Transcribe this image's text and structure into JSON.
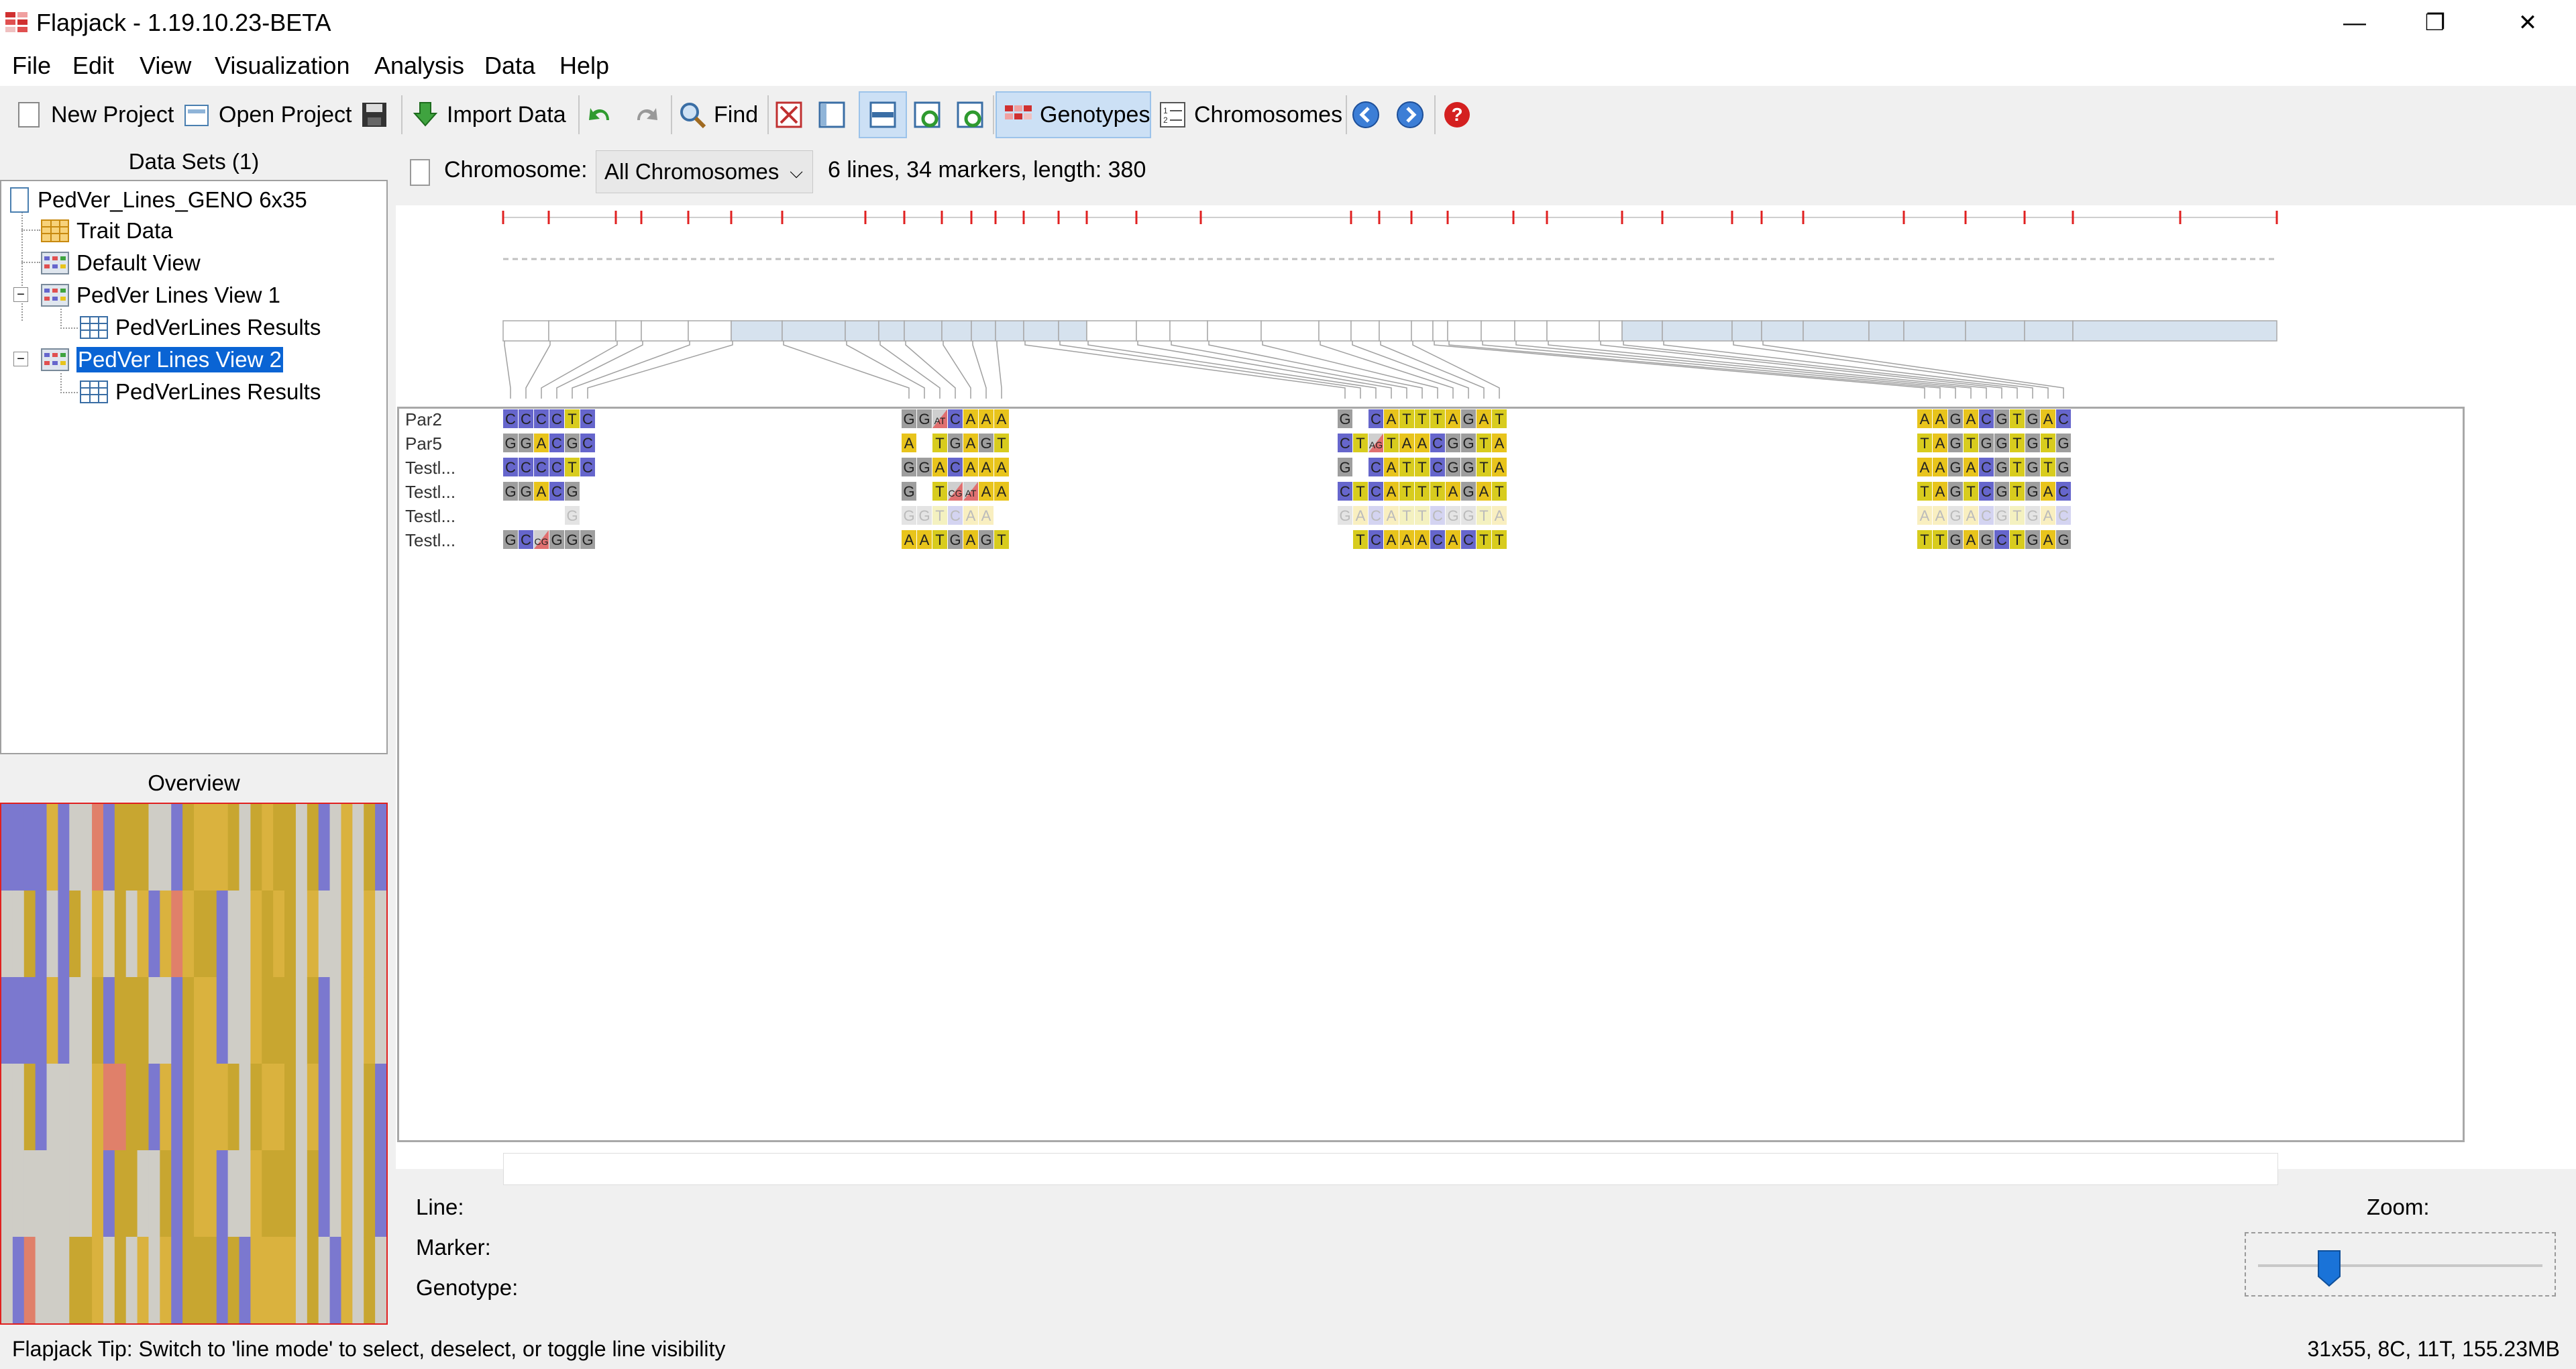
{
  "window": {
    "title": "Flapjack - 1.19.10.23-BETA",
    "min_icon": "—",
    "max_icon": "❐",
    "close_icon": "✕"
  },
  "menu": [
    "File",
    "Edit",
    "View",
    "Visualization",
    "Analysis",
    "Data",
    "Help"
  ],
  "toolbar": {
    "new_project": "New Project",
    "open_project": "Open Project",
    "import_data": "Import Data",
    "find": "Find",
    "genotypes": "Genotypes",
    "chromosomes": "Chromosomes"
  },
  "datasets": {
    "header": "Data Sets (1)",
    "root": "PedVer_Lines_GENO 6x35",
    "trait": "Trait Data",
    "default_view": "Default View",
    "view1": "PedVer Lines View 1",
    "view1_results": "PedVerLines Results",
    "view2": "PedVer Lines View 2",
    "view2_results": "PedVerLines Results"
  },
  "overview": {
    "header": "Overview"
  },
  "chromosome": {
    "label": "Chromosome:",
    "selected": "All Chromosomes",
    "info": "6 lines, 34 markers, length: 380"
  },
  "lines": [
    "Par2",
    "Par5",
    "Testl...",
    "Testl...",
    "Testl...",
    "Testl..."
  ],
  "genotype_blocks": [
    {
      "rows": [
        [
          "C",
          "C",
          "C",
          "C",
          "T",
          "C"
        ],
        [
          "G",
          "G",
          "A",
          "C",
          "G",
          "C"
        ],
        [
          "C",
          "C",
          "C",
          "C",
          "T",
          "C"
        ],
        [
          "G",
          "G",
          "A",
          "C",
          "G",
          ""
        ],
        [
          "",
          "",
          "",
          "",
          "G",
          ""
        ],
        [
          "G",
          "C",
          "C/G",
          "G",
          "G",
          "G"
        ]
      ]
    },
    {
      "rows": [
        [
          "G",
          "G",
          "A/T",
          "C",
          "A",
          "A",
          "A"
        ],
        [
          "A",
          "",
          "T",
          "G",
          "A",
          "G",
          "T"
        ],
        [
          "G",
          "G",
          "A",
          "C",
          "A",
          "A",
          "A"
        ],
        [
          "G",
          "",
          "T",
          "C/G",
          "A/T",
          "A",
          "A"
        ],
        [
          "G",
          "G",
          "T",
          "C",
          "A",
          "A",
          ""
        ],
        [
          "A",
          "A",
          "T",
          "G",
          "A",
          "G",
          "T"
        ]
      ]
    },
    {
      "rows": [
        [
          "G",
          "",
          "C",
          "A",
          "T",
          "T",
          "T",
          "A",
          "G",
          "A",
          "T"
        ],
        [
          "C",
          "T",
          "A/G",
          "T",
          "A",
          "A",
          "C",
          "G",
          "G",
          "T",
          "A"
        ],
        [
          "G",
          "",
          "C",
          "A",
          "T",
          "T",
          "C",
          "G",
          "G",
          "T",
          "A"
        ],
        [
          "C",
          "T",
          "C",
          "A",
          "T",
          "T",
          "T",
          "A",
          "G",
          "A",
          "T"
        ],
        [
          "G",
          "A",
          "C",
          "A",
          "T",
          "T",
          "C",
          "G",
          "G",
          "T",
          "A"
        ],
        [
          "",
          "T",
          "C",
          "A",
          "A",
          "A",
          "C",
          "A",
          "C",
          "T",
          "T"
        ]
      ]
    },
    {
      "rows": [
        [
          "A",
          "A",
          "G",
          "A",
          "C",
          "G",
          "T",
          "G",
          "A",
          "C"
        ],
        [
          "T",
          "A",
          "G",
          "T",
          "G",
          "G",
          "T",
          "G",
          "T",
          "G"
        ],
        [
          "A",
          "A",
          "G",
          "A",
          "C",
          "G",
          "T",
          "G",
          "T",
          "G"
        ],
        [
          "T",
          "A",
          "G",
          "T",
          "C",
          "G",
          "T",
          "G",
          "A",
          "C"
        ],
        [
          "A",
          "A",
          "G",
          "A",
          "C",
          "G",
          "T",
          "G",
          "A",
          "C"
        ],
        [
          "T",
          "T",
          "G",
          "A",
          "G",
          "C",
          "T",
          "G",
          "A",
          "G"
        ]
      ]
    }
  ],
  "colors": {
    "A": "#e8c41c",
    "C": "#6666cc",
    "G": "#9e9e9e",
    "T": "#d8cc1e",
    "het": "#e07070",
    "selected": "#0a64d4",
    "overview_border": "#e02020"
  },
  "info": {
    "line": "Line:",
    "marker": "Marker:",
    "genotype": "Genotype:"
  },
  "zoom": {
    "label": "Zoom:",
    "level": 0.25
  },
  "status": {
    "tip": "Flapjack Tip: Switch to 'line mode' to select, deselect, or toggle line visibility",
    "memory": "31x55, 8C, 11T, 155.23MB"
  }
}
